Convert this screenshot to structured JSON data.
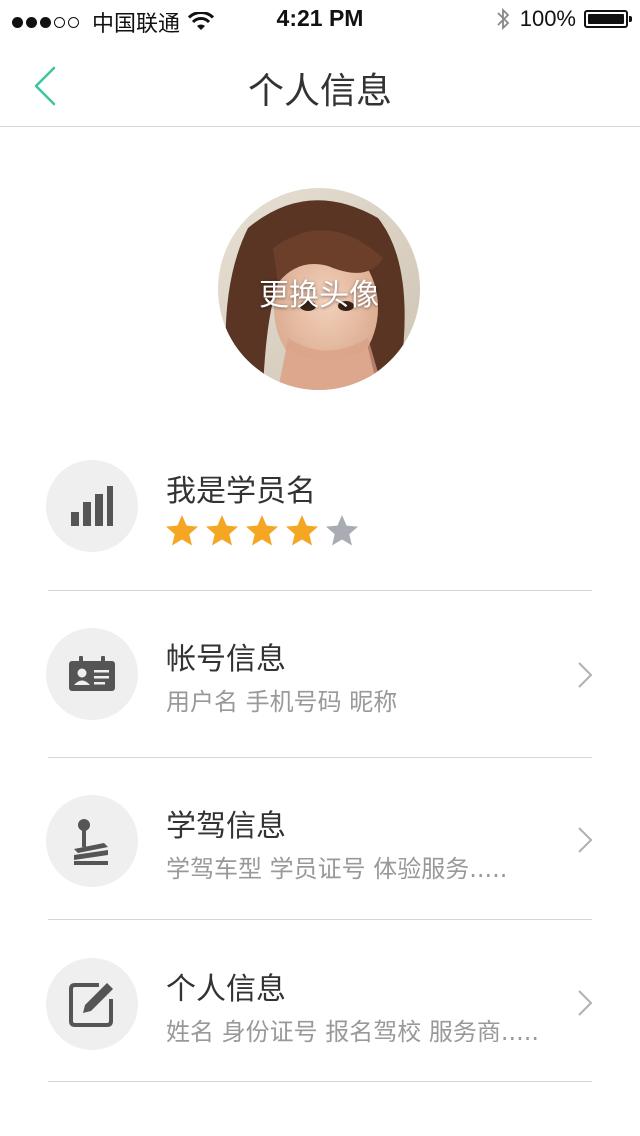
{
  "status_bar": {
    "carrier": "中国联通",
    "time": "4:21 PM",
    "battery": "100%"
  },
  "nav": {
    "title": "个人信息"
  },
  "avatar": {
    "label": "更换头像"
  },
  "profile": {
    "name": "我是学员名",
    "rating": 4,
    "max_rating": 5
  },
  "rows": [
    {
      "title": "帐号信息",
      "subtitle": "用户名  手机号码  昵称",
      "icon": "id-card-icon"
    },
    {
      "title": "学驾信息",
      "subtitle": "学驾车型  学员证号  体验服务.....",
      "icon": "gear-shift-icon"
    },
    {
      "title": "个人信息",
      "subtitle": "姓名  身份证号  报名驾校  服务商.....",
      "icon": "edit-icon"
    }
  ],
  "colors": {
    "accent": "#3cc3a0",
    "icon_bg": "#efefef",
    "icon_fg": "#555555",
    "star_on": "#f5a623",
    "star_off": "#a9adb3"
  }
}
